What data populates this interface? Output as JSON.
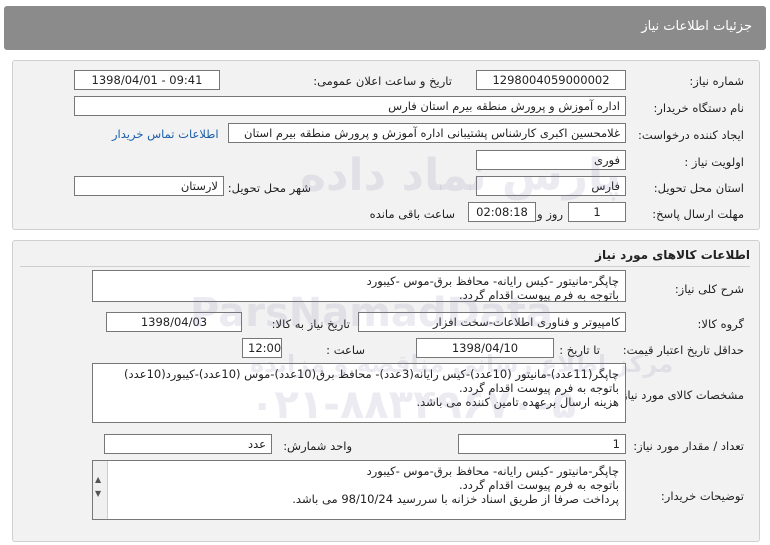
{
  "page_title": "جزئیات اطلاعات نیاز",
  "need_number": {
    "label": "شماره نیاز:",
    "value": "1298004059000002"
  },
  "announce": {
    "label": "تاریخ و ساعت اعلان عمومی:",
    "value": "1398/04/01 - 09:41"
  },
  "buyer_org": {
    "label": "نام دستگاه خریدار:",
    "value": "اداره آموزش و پرورش منطقه بیرم استان فارس"
  },
  "creator": {
    "label": "ایجاد کننده درخواست:",
    "value": "غلامحسین اکبری کارشناس پشتیبانی اداره آموزش و پرورش منطقه بیرم استان",
    "link": "اطلاعات تماس خریدار"
  },
  "priority": {
    "label": "اولویت نیاز :",
    "value": "فوری"
  },
  "province": {
    "label": "استان محل تحویل:",
    "value": "فارس"
  },
  "city": {
    "label": "شهر محل تحویل:",
    "value": "لارستان"
  },
  "deadline": {
    "label": "مهلت ارسال پاسخ:",
    "days": "1",
    "days_label": "روز و",
    "time": "02:08:18",
    "remaining_label": "ساعت باقی مانده"
  },
  "goods_section": {
    "title": "اطلاعات کالاهای مورد نیاز"
  },
  "general_desc": {
    "label": "شرح کلی نیاز:",
    "value": "چاپگر-مانیتور -کیس رایانه- محافظ برق-موس -کیبورد\nباتوجه به فرم پیوست اقدام گردد."
  },
  "goods_group": {
    "label": "گروه کالا:",
    "value": "کامپیوتر و فناوری اطلاعات-سخت افزار"
  },
  "need_date": {
    "label": "تاریخ نیاز به کالا:",
    "value": "1398/04/03"
  },
  "price_validity": {
    "label": "حداقل تاریخ اعتبار قیمت:",
    "to_date_label": "تا تاریخ :",
    "date": "1398/04/10",
    "time_label": "ساعت :",
    "time": "12:00"
  },
  "specs": {
    "label": "مشخصات کالای مورد نیاز:",
    "value": "چاپگر(11عدد)-مانیتور (10عدد)-کیس رایانه(3عدد)- محافظ برق(10عدد)-موس (10عدد)-کیبورد(10عدد)\nباتوجه به فرم پیوست اقدام گردد.\nهزینه ارسال برعهده تامین کننده می باشد."
  },
  "quantity": {
    "label": "تعداد / مقدار مورد نیاز:",
    "value": "1"
  },
  "unit": {
    "label": "واحد شمارش:",
    "value": "عدد"
  },
  "buyer_notes": {
    "label": "توضیحات خریدار:",
    "value": "چاپگر-مانیتور -کیس رایانه- محافظ برق-موس -کیبورد\nباتوجه به فرم پیوست اقدام گردد.\nپرداخت صرفا از طریق اسناد خزانه با سررسید 98/10/24 می باشد."
  },
  "watermark": {
    "line1": "پارس نماد داده",
    "line2": "ParsNamadData",
    "line3": "مرکز اطلاع رسانی مناقصه و مزایده",
    "phone": "۰۲۱-۸۸۳۴۹۶۷۰-۵"
  }
}
